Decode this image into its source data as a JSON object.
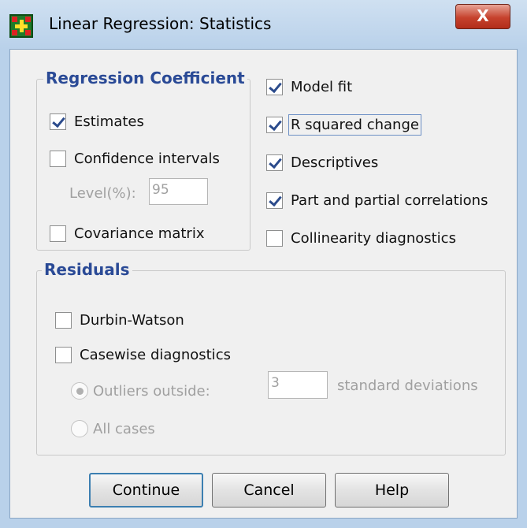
{
  "window": {
    "title": "Linear Regression: Statistics",
    "close_label": "X"
  },
  "regression_coefficients": {
    "title": "Regression Coefficient",
    "estimates": {
      "label": "Estimates",
      "checked": true
    },
    "confidence_intervals": {
      "label": "Confidence intervals",
      "checked": false
    },
    "level_label": "Level(%):",
    "level_value": "95",
    "covariance_matrix": {
      "label": "Covariance matrix",
      "checked": false
    }
  },
  "options": {
    "model_fit": {
      "label": "Model fit",
      "checked": true
    },
    "r_squared_change": {
      "label": "R squared change",
      "checked": true
    },
    "descriptives": {
      "label": "Descriptives",
      "checked": true
    },
    "part_partial": {
      "label": "Part and partial correlations",
      "checked": true
    },
    "collinearity": {
      "label": "Collinearity diagnostics",
      "checked": false
    }
  },
  "residuals": {
    "title": "Residuals",
    "durbin_watson": {
      "label": "Durbin-Watson",
      "checked": false
    },
    "casewise": {
      "label": "Casewise diagnostics",
      "checked": false
    },
    "outliers_label": "Outliers outside:",
    "outliers_value": "3",
    "std_dev_label": "standard deviations",
    "all_cases_label": "All cases"
  },
  "buttons": {
    "continue": "Continue",
    "cancel": "Cancel",
    "help": "Help"
  },
  "colors": {
    "group_title": "#2a4a96",
    "dialog_bg": "#f0f0f0",
    "frame": "#b9d1ea",
    "close_button": "#c6422d"
  }
}
